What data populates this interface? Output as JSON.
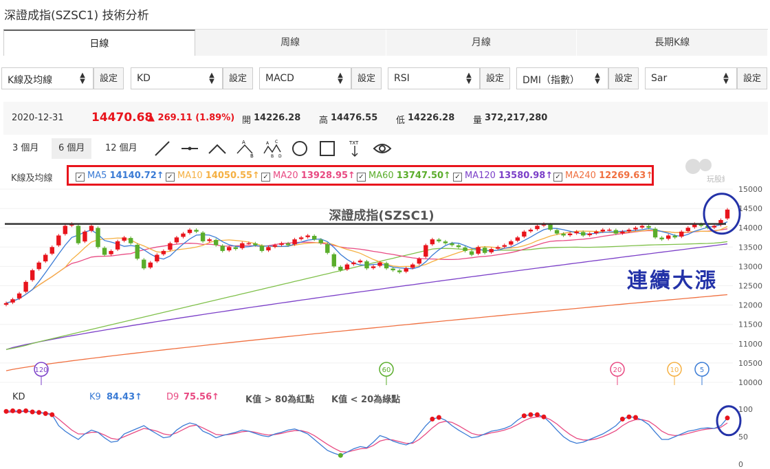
{
  "page_title": "深證成指(SZSC1) 技術分析",
  "tabs": [
    {
      "label": "日線",
      "active": true
    },
    {
      "label": "周線"
    },
    {
      "label": "月線"
    },
    {
      "label": "長期K線"
    }
  ],
  "selectors": [
    {
      "value": "K線及均線",
      "button": "設定"
    },
    {
      "value": "KD",
      "button": "設定"
    },
    {
      "value": "MACD",
      "button": "設定"
    },
    {
      "value": "RSI",
      "button": "設定"
    },
    {
      "value": "DMI（指數）",
      "button": "設定"
    },
    {
      "value": "Sar",
      "button": "設定"
    }
  ],
  "quote": {
    "date": "2020-12-31",
    "price": "14470.68",
    "change": "▲ 269.11 (1.89%)",
    "open_label": "開",
    "open": "14226.28",
    "high_label": "高",
    "high": "14476.55",
    "low_label": "低",
    "low": "14226.28",
    "vol_label": "量",
    "vol": "372,217,280"
  },
  "colors": {
    "up": "#e8141c",
    "down": "#5aad2b",
    "ma5": "#3a7bd5",
    "ma10": "#f5b042",
    "ma20": "#e84a82",
    "ma60": "#7fc04a",
    "ma120": "#7b3fc8",
    "ma240": "#f07040",
    "k9": "#3a7bd5",
    "d9": "#e84a82"
  },
  "ranges": [
    "3 個月",
    "6 個月",
    "12 個月"
  ],
  "active_range": "6 個月",
  "tools": [
    "line-tool-icon",
    "horizontal-line-icon",
    "angle-icon",
    "abc-pattern-icon",
    "abcd-pattern-icon",
    "circle-tool-icon",
    "rect-tool-icon",
    "text-tool-icon",
    "eye-icon"
  ],
  "tool_text": {
    "txt": "TXT",
    "a": "A",
    "b": "B",
    "c": "C",
    "d": "D"
  },
  "ma_panel_label": "K線及均線",
  "ma_legend": [
    {
      "name": "MA5",
      "value": "14140.72↑",
      "color": "#3a7bd5"
    },
    {
      "name": "MA10",
      "value": "14050.55↑",
      "color": "#f5b042"
    },
    {
      "name": "MA20",
      "value": "13928.95↑",
      "color": "#e84a82"
    },
    {
      "name": "MA60",
      "value": "13747.50↑",
      "color": "#5aad2b"
    },
    {
      "name": "MA120",
      "value": "13580.98↑",
      "color": "#7b3fc8"
    },
    {
      "name": "MA240",
      "value": "12269.63↑",
      "color": "#f07040"
    }
  ],
  "checkbox_mark": "✓",
  "logo_text": "玩股網",
  "chart_data": {
    "type": "candlestick",
    "title": "深證成指(SZSC1)",
    "annotation": "連續大漲",
    "y_ticks": [
      15000,
      14500,
      14000,
      13500,
      13000,
      12500,
      12000,
      11500,
      11000,
      10500,
      10000
    ],
    "ylim": [
      10000,
      15000
    ],
    "resistance_line": 14100,
    "last_close": 14470.68,
    "ma_markers": [
      {
        "label": "120",
        "color": "#7b3fc8"
      },
      {
        "label": "60",
        "color": "#5aad2b"
      },
      {
        "label": "20",
        "color": "#e84a82"
      },
      {
        "label": "10",
        "color": "#f5b042"
      },
      {
        "label": "5",
        "color": "#3a7bd5"
      }
    ],
    "closes": [
      12050,
      12150,
      12300,
      12600,
      12900,
      13100,
      13300,
      13500,
      13800,
      14050,
      14100,
      13600,
      13900,
      14050,
      13500,
      13300,
      13400,
      13650,
      13750,
      13600,
      13200,
      12950,
      13100,
      13300,
      13400,
      13600,
      13750,
      13850,
      13950,
      13900,
      13650,
      13700,
      13550,
      13400,
      13500,
      13450,
      13600,
      13600,
      13550,
      13400,
      13500,
      13550,
      13600,
      13550,
      13700,
      13750,
      13800,
      13700,
      13600,
      13350,
      13000,
      12900,
      13050,
      13100,
      13150,
      12950,
      13000,
      13100,
      12950,
      12900,
      12850,
      12950,
      13050,
      13200,
      13550,
      13700,
      13650,
      13600,
      13550,
      13500,
      13400,
      13300,
      13500,
      13350,
      13450,
      13500,
      13550,
      13650,
      13750,
      13900,
      13950,
      14050,
      14100,
      13950,
      13850,
      13800,
      13850,
      13900,
      13800,
      13850,
      13900,
      13950,
      13950,
      13850,
      13900,
      13950,
      14000,
      14050,
      14000,
      13750,
      13700,
      13800,
      13750,
      13900,
      14000,
      14100,
      14050,
      14000,
      14050,
      14200,
      14470
    ],
    "ma240_range": [
      10300,
      12269
    ],
    "ma120_range": [
      10850,
      13581
    ],
    "kd": {
      "label": "KD",
      "k_label": "K9",
      "k_value": "84.43↑",
      "d_label": "D9",
      "d_value": "75.56↑",
      "note_red": "K值 > 80為紅點",
      "note_green": "K值 < 20為綠點",
      "y_ticks": [
        100,
        50,
        0
      ],
      "k": [
        96,
        97,
        96,
        97,
        95,
        94,
        92,
        90,
        70,
        60,
        52,
        45,
        55,
        62,
        58,
        48,
        40,
        42,
        55,
        60,
        65,
        70,
        62,
        55,
        48,
        50,
        62,
        70,
        75,
        72,
        60,
        55,
        48,
        52,
        55,
        58,
        62,
        60,
        56,
        52,
        50,
        55,
        58,
        62,
        64,
        60,
        55,
        45,
        35,
        25,
        20,
        16,
        22,
        28,
        32,
        30,
        40,
        52,
        48,
        42,
        38,
        35,
        40,
        55,
        70,
        82,
        85,
        80,
        70,
        62,
        55,
        48,
        50,
        55,
        60,
        62,
        65,
        70,
        80,
        88,
        90,
        90,
        86,
        75,
        62,
        50,
        42,
        38,
        40,
        45,
        50,
        55,
        62,
        70,
        82,
        86,
        85,
        80,
        72,
        58,
        45,
        45,
        50,
        55,
        60,
        62,
        65,
        66,
        65,
        70,
        84
      ],
      "d": [
        94,
        95,
        95,
        96,
        95,
        94,
        93,
        91,
        82,
        72,
        62,
        55,
        55,
        58,
        58,
        53,
        47,
        45,
        50,
        55,
        60,
        65,
        63,
        60,
        55,
        53,
        57,
        63,
        69,
        71,
        66,
        60,
        54,
        53,
        54,
        56,
        59,
        60,
        58,
        55,
        53,
        54,
        56,
        59,
        61,
        61,
        58,
        52,
        44,
        36,
        29,
        23,
        22,
        25,
        28,
        29,
        34,
        42,
        45,
        44,
        41,
        38,
        38,
        45,
        55,
        66,
        75,
        78,
        76,
        70,
        63,
        56,
        53,
        54,
        57,
        59,
        62,
        66,
        72,
        79,
        84,
        86,
        86,
        81,
        73,
        63,
        54,
        47,
        44,
        44,
        46,
        50,
        55,
        61,
        70,
        77,
        81,
        81,
        78,
        70,
        60,
        54,
        52,
        53,
        56,
        59,
        62,
        64,
        65,
        67,
        75
      ]
    }
  }
}
